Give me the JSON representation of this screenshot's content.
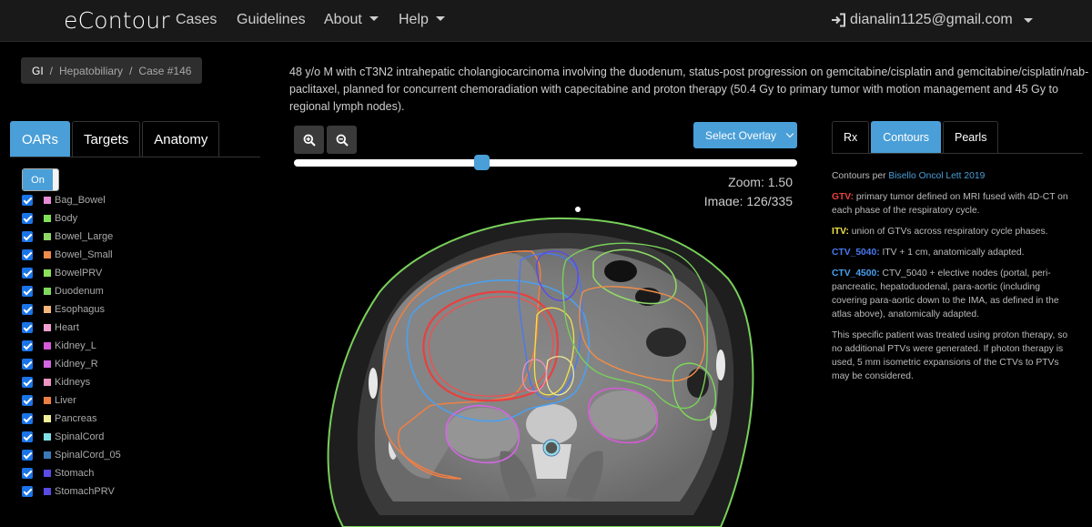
{
  "nav": {
    "brand": "eContour",
    "cases": "Cases",
    "guidelines": "Guidelines",
    "about": "About",
    "help": "Help",
    "user": "dianalin1125@gmail.com"
  },
  "breadcrumb": {
    "site": "GI",
    "subsite": "Hepatobiliary",
    "case": "Case #146"
  },
  "case_description": "48 y/o M with cT3N2 intrahepatic cholangiocarcinoma involving the duodenum, status-post progression on gemcitabine/cisplatin and gemcitabine/cisplatin/nab-paclitaxel, planned for concurrent chemoradiation with capecitabine and proton therapy (50.4 Gy to primary tumor with motion management and 45 Gy to regional lymph nodes).",
  "left_tabs": [
    "OARs",
    "Targets",
    "Anatomy"
  ],
  "toggle_label": "On",
  "oars": [
    {
      "label": "Bag_Bowel",
      "color": "#e88bd6"
    },
    {
      "label": "Body",
      "color": "#7fe05a"
    },
    {
      "label": "Bowel_Large",
      "color": "#8fd866"
    },
    {
      "label": "Bowel_Small",
      "color": "#f08d4a"
    },
    {
      "label": "BowelPRV",
      "color": "#8ee05b"
    },
    {
      "label": "Duodenum",
      "color": "#7ed85c"
    },
    {
      "label": "Esophagus",
      "color": "#f4b67a"
    },
    {
      "label": "Heart",
      "color": "#f0a0d0"
    },
    {
      "label": "Kidney_L",
      "color": "#d85ad8"
    },
    {
      "label": "Kidney_R",
      "color": "#d466e4"
    },
    {
      "label": "Kidneys",
      "color": "#ef93c3"
    },
    {
      "label": "Liver",
      "color": "#ee7f44"
    },
    {
      "label": "Pancreas",
      "color": "#f1f09a"
    },
    {
      "label": "SpinalCord",
      "color": "#7fe0e8"
    },
    {
      "label": "SpinalCord_05",
      "color": "#3a7ab8"
    },
    {
      "label": "Stomach",
      "color": "#5b4be8"
    },
    {
      "label": "StomachPRV",
      "color": "#5a4ae4"
    }
  ],
  "viewer": {
    "overlay_label": "Select Overlay",
    "zoom_label": "Zoom: 1.50",
    "image_label": "Image: 126/335",
    "slice_fraction": 0.373
  },
  "right_tabs": [
    "Rx",
    "Contours",
    "Pearls"
  ],
  "contours_panel": {
    "intro": "Contours per",
    "reference": "Bisello Oncol Lett 2019",
    "gtv_label": "GTV:",
    "gtv_color": "#e84040",
    "gtv_text": "primary tumor defined on MRI fused with 4D-CT on each phase of the respiratory cycle.",
    "itv_label": "ITV:",
    "itv_color": "#f1e24a",
    "itv_text": "union of GTVs across respiratory cycle phases.",
    "ctv5040_label": "CTV_5040:",
    "ctv5040_color": "#4a78f0",
    "ctv5040_text": "ITV + 1 cm, anatomically adapted.",
    "ctv4500_label": "CTV_4500:",
    "ctv4500_color": "#4aa0f0",
    "ctv4500_text": "CTV_5040 + elective nodes (portal, peri-pancreatic, hepatoduodenal, para-aortic (including covering para-aortic down to the IMA, as defined in the atlas above), anatomically adapted.",
    "note": "This specific patient was treated using proton therapy, so no additional PTVs were generated. If photon therapy is used, 5 mm isometric expansions of the CTVs to PTVs may be considered."
  }
}
